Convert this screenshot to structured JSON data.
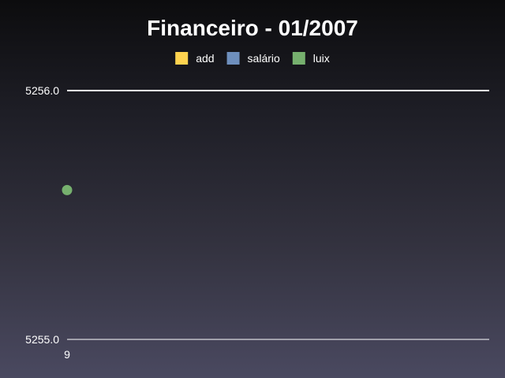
{
  "chart_data": {
    "type": "line",
    "title": "Financeiro - 01/2007",
    "xlabel": "",
    "ylabel": "",
    "categories": [
      "9"
    ],
    "series": [
      {
        "name": "add",
        "color": "#ffd34f",
        "values": [
          null
        ]
      },
      {
        "name": "salário",
        "color": "#6e8fbd",
        "values": [
          null
        ]
      },
      {
        "name": "luix",
        "color": "#76b06e",
        "values": [
          5255.6
        ]
      }
    ],
    "ylim": [
      5255.0,
      5256.0
    ],
    "y_ticks": [
      "5256.0",
      "5255.0"
    ],
    "legend": "top-center",
    "grid": true
  }
}
